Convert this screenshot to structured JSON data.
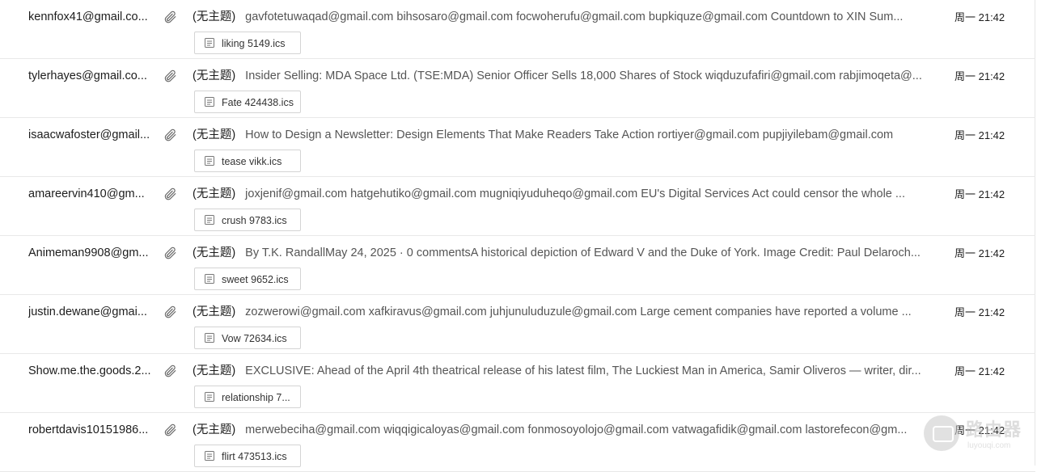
{
  "mail_list": {
    "rows": [
      {
        "sender": "kennfox41@gmail.co...",
        "subject": "(无主题)",
        "preview": "gavfotetuwaqad@gmail.com bihsosaro@gmail.com focwoherufu@gmail.com bupkiquze@gmail.com Countdown to XIN Sum...",
        "time": "周一 21:42",
        "attachment": "liking 5149.ics"
      },
      {
        "sender": "tylerhayes@gmail.co...",
        "subject": "(无主题)",
        "preview": "Insider Selling: MDA Space Ltd. (TSE:MDA) Senior Officer Sells 18,000 Shares of Stock wiqduzufafiri@gmail.com rabjimoqeta@...",
        "time": "周一 21:42",
        "attachment": "Fate 424438.ics"
      },
      {
        "sender": "isaacwafoster@gmail...",
        "subject": "(无主题)",
        "preview": "How to Design a Newsletter: Design Elements That Make Readers Take Action rortiyer@gmail.com pupjiyilebam@gmail.com",
        "time": "周一 21:42",
        "attachment": "tease vikk.ics"
      },
      {
        "sender": "amareervin410@gm...",
        "subject": "(无主题)",
        "preview": "joxjenif@gmail.com hatgehutiko@gmail.com mugniqiyuduheqo@gmail.com EU's Digital Services Act could censor the whole ...",
        "time": "周一 21:42",
        "attachment": "crush 9783.ics"
      },
      {
        "sender": "Animeman9908@gm...",
        "subject": "(无主题)",
        "preview": "By T.K. RandallMay 24, 2025 · 0 commentsA historical depiction of Edward V and the Duke of York. Image Credit: Paul Delaroch...",
        "time": "周一 21:42",
        "attachment": "sweet 9652.ics"
      },
      {
        "sender": "justin.dewane@gmai...",
        "subject": "(无主题)",
        "preview": "zozwerowi@gmail.com xafkiravus@gmail.com juhjunuluduzule@gmail.com Large cement companies have reported a volume ...",
        "time": "周一 21:42",
        "attachment": "Vow 72634.ics"
      },
      {
        "sender": "Show.me.the.goods.2...",
        "subject": "(无主题)",
        "preview": "EXCLUSIVE: Ahead of the April 4th theatrical release of his latest film, The Luckiest Man in America, Samir Oliveros — writer, dir...",
        "time": "周一 21:42",
        "attachment": "relationship 7..."
      },
      {
        "sender": "robertdavis10151986...",
        "subject": "(无主题)",
        "preview": "merwebeciha@gmail.com wiqqigicaloyas@gmail.com fonmosoyolojo@gmail.com vatwagafidik@gmail.com lastorefecon@gm...",
        "time": "周一 21:42",
        "attachment": "flirt 473513.ics"
      }
    ]
  },
  "watermark": {
    "text": "路由器",
    "sub": "luyouqi.com"
  },
  "colors": {
    "border": "#e8e8e8",
    "text": "#1c1c1c",
    "preview_text": "#555555",
    "chip_border": "#d4d4d4"
  },
  "icons": {
    "attachment_indicator": "paperclip-icon",
    "file": "file-icon"
  }
}
